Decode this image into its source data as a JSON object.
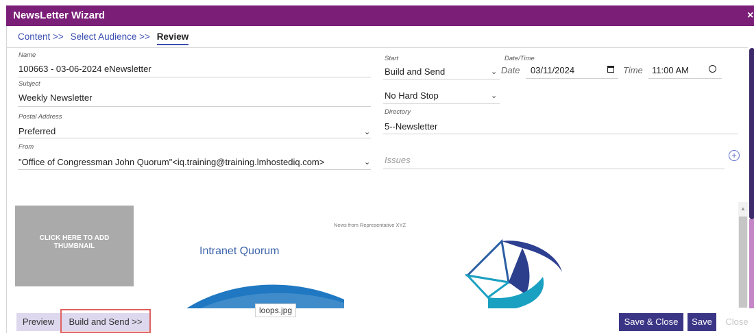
{
  "window": {
    "title": "NewsLetter Wizard",
    "close": "×"
  },
  "breadcrumb": {
    "steps": [
      "Content >>",
      "Select Audience >>",
      "Review"
    ]
  },
  "form": {
    "name": {
      "label": "Name",
      "value": "100663 - 03-06-2024 eNewsletter"
    },
    "subject": {
      "label": "Subject",
      "value": "Weekly Newsletter"
    },
    "postal_address": {
      "label": "Postal Address",
      "value": "Preferred"
    },
    "from": {
      "label": "From",
      "value": "\"Office of Congressman John Quorum\"<iq.training@training.lmhostediq.com>"
    },
    "start": {
      "label": "Start",
      "value": "Build and Send"
    },
    "datetime": {
      "label": "Date/Time",
      "date_label": "Date",
      "date_value": "03/11/2024",
      "time_label": "Time",
      "time_value": "11:00 AM"
    },
    "hard_stop": {
      "value": "No Hard Stop"
    },
    "directory": {
      "label": "Directory",
      "value": "5--Newsletter"
    },
    "issues": {
      "placeholder": "Issues"
    }
  },
  "preview": {
    "thumbnail_text": "CLICK HERE TO ADD THUMBNAIL",
    "news_from": "News from Representative XYZ",
    "banner_title": "Intranet Quorum",
    "tooltip": "loops.jpg"
  },
  "footer": {
    "preview": "Preview",
    "build_send": "Build and Send >>",
    "save_close": "Save & Close",
    "save": "Save",
    "close": "Close"
  },
  "colors": {
    "titlebar": "#7a1e78",
    "accent": "#3a3585",
    "light_button": "#ddd8ee",
    "highlight": "#e06060"
  }
}
